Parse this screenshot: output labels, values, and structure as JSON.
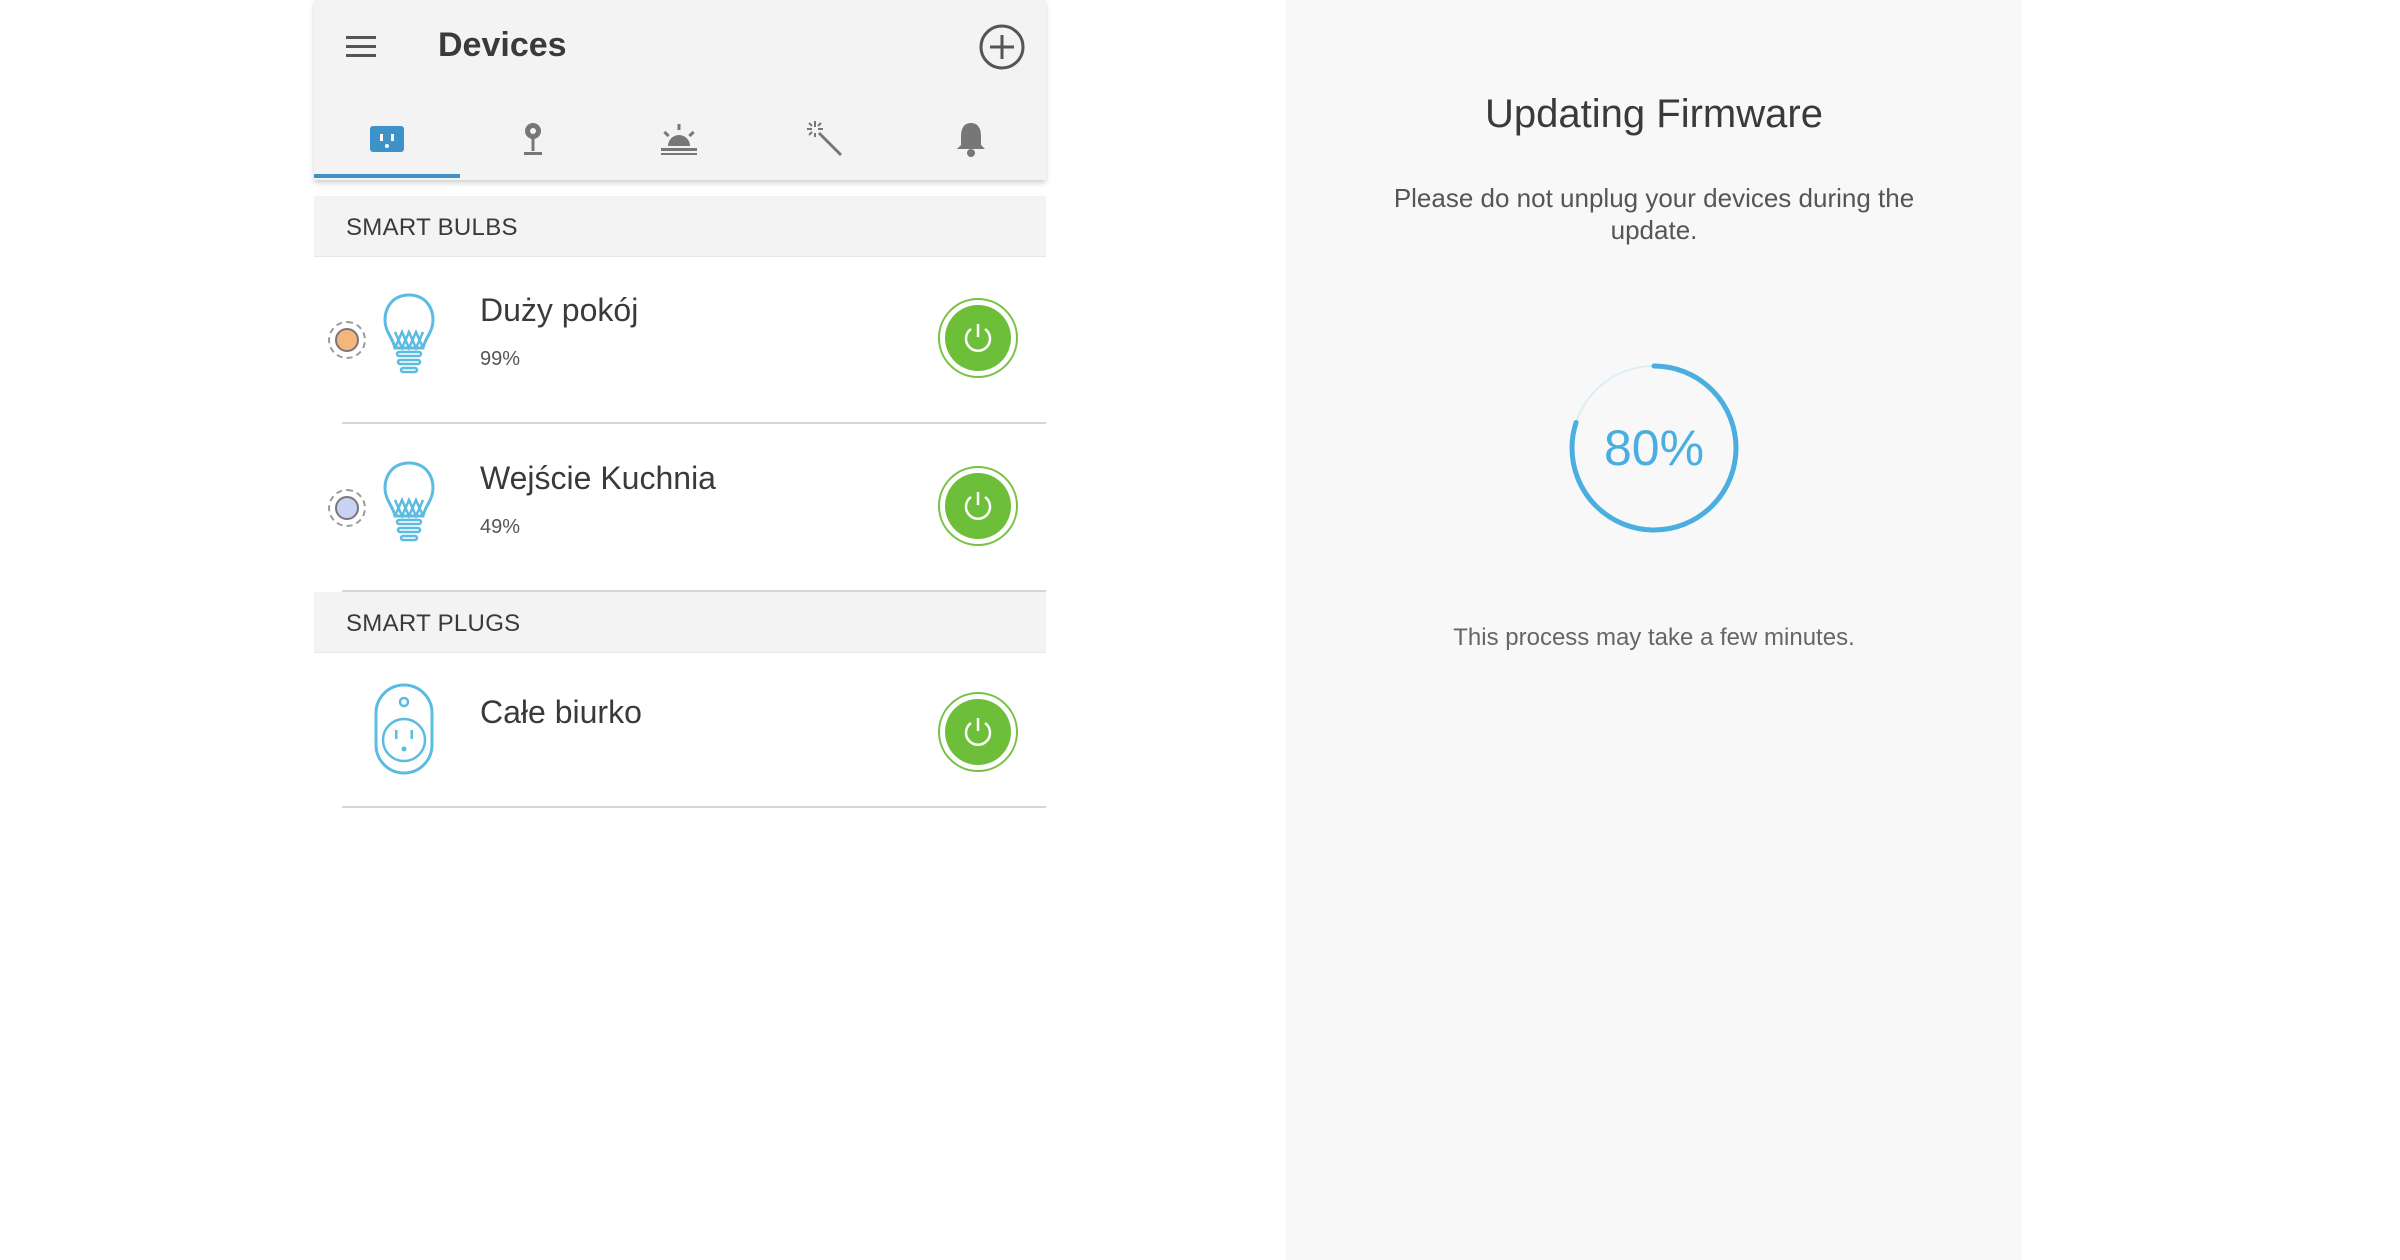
{
  "header": {
    "title": "Devices",
    "menu_icon": "hamburger-icon",
    "add_icon": "add-circle-icon"
  },
  "tabs": [
    {
      "name": "devices",
      "icon": "plug-icon",
      "selected": true
    },
    {
      "name": "away-mode",
      "icon": "pin-icon",
      "selected": false
    },
    {
      "name": "schedule",
      "icon": "sunrise-icon",
      "selected": false
    },
    {
      "name": "scenes",
      "icon": "magic-wand-icon",
      "selected": false
    },
    {
      "name": "notifications",
      "icon": "bell-icon",
      "selected": false
    }
  ],
  "sections": {
    "bulbs": {
      "label": "SMART BULBS",
      "devices": [
        {
          "name": "Duży pokój",
          "brightness": "99%",
          "light_color": "#f6b57a",
          "power": "on"
        },
        {
          "name": "Wejście Kuchnia",
          "brightness": "49%",
          "light_color": "#c8d2f5",
          "power": "on"
        }
      ]
    },
    "plugs": {
      "label": "SMART PLUGS",
      "devices": [
        {
          "name": "Całe biurko",
          "power": "on"
        }
      ]
    }
  },
  "firmware": {
    "title": "Updating Firmware",
    "warning": "Please do not unplug your devices during the update.",
    "progress_text": "80%",
    "progress_value": 0.8,
    "note": "This process may take a few minutes."
  },
  "colors": {
    "accent_blue": "#3d93c8",
    "power_green": "#6dbf3a",
    "progress_blue": "#4aaee0"
  }
}
